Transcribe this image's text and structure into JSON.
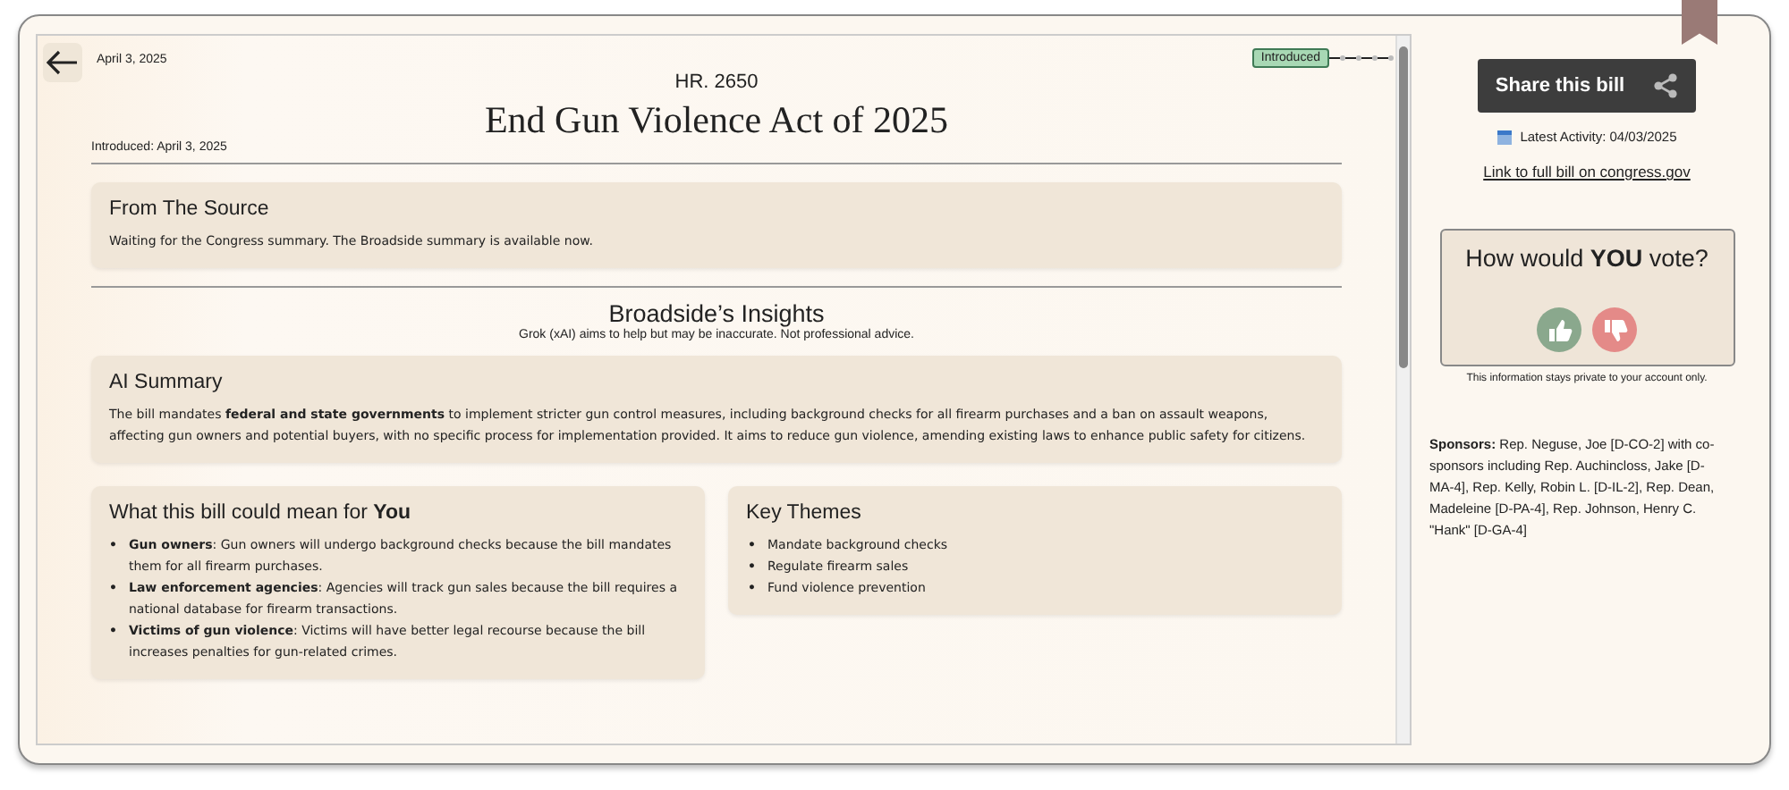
{
  "header": {
    "date": "April 3, 2025",
    "bill_number": "HR. 2650",
    "title": "End Gun Violence Act of 2025",
    "introduced": "Introduced: April 3, 2025"
  },
  "timeline": [
    {
      "label": "Introduced",
      "selected": true
    },
    {
      "selected": false
    },
    {
      "selected": false
    },
    {
      "selected": false
    },
    {
      "selected": false
    }
  ],
  "source": {
    "title": "From The Source",
    "text": "Waiting for the Congress summary. The Broadside summary is available now."
  },
  "insights": {
    "title": "Broadside’s Insights",
    "disclaimer": "Grok (xAI) aims to help but may be inaccurate. Not professional advice."
  },
  "ai_summary": {
    "title": "AI Summary",
    "text": "The bill mandates **federal and state governments** to implement stricter gun control measures, including background checks for all firearm purchases and a ban on assault weapons, affecting gun owners and potential buyers, with no specific process for implementation provided. It aims to reduce gun violence, amending existing laws to enhance public safety for citizens."
  },
  "impact": {
    "title": "What this bill could mean for **You**",
    "items": [
      {
        "marker": "•",
        "text": "**Gun owners**: Gun owners will undergo background checks because the bill mandates them for all firearm purchases."
      },
      {
        "marker": "•",
        "text": "**Law enforcement agencies**: Agencies will track gun sales because the bill requires a national database for firearm transactions."
      },
      {
        "marker": "•",
        "text": "**Victims of gun violence**: Victims will have better legal recourse because the bill increases penalties for gun-related crimes."
      }
    ]
  },
  "key_themes": {
    "title": "Key Themes",
    "items": [
      {
        "marker": "•",
        "text": "Mandate background checks"
      },
      {
        "marker": "•",
        "text": "Regulate firearm sales"
      },
      {
        "marker": "•",
        "text": "Fund violence prevention"
      }
    ]
  },
  "sidebar": {
    "share_label": "Share this bill",
    "latest_activity": "Latest Activity: 04/03/2025",
    "congress_link": "Link to full bill on congress.gov",
    "vote_question": "How would **YOU** vote?",
    "privacy_note": "This information stays private to your account only.",
    "sponsors_label": "Sponsors:",
    "sponsors_text": "Rep. Neguse, Joe [D-CO-2] with co-sponsors including Rep. Auchincloss, Jake [D-MA-4], Rep. Kelly, Robin L. [D-IL-2], Rep. Dean, Madeleine [D-PA-4], Rep. Johnson, Henry C. \"Hank\" [D-GA-4]"
  }
}
